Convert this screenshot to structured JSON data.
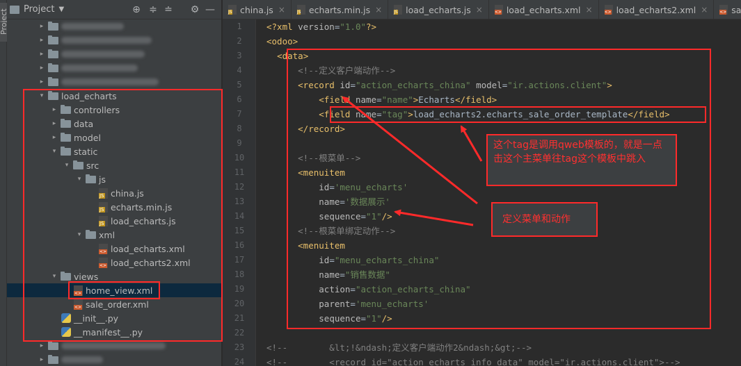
{
  "left_strip": {
    "label": "Project"
  },
  "project_panel": {
    "title": "Project",
    "tree": [
      {
        "label": "",
        "type": "folder",
        "blurred": true,
        "expanded": false
      },
      {
        "label": "",
        "type": "folder",
        "blurred": true,
        "expanded": false
      },
      {
        "label": "",
        "type": "folder",
        "blurred": true,
        "expanded": false
      },
      {
        "label": "",
        "type": "folder",
        "blurred": true,
        "expanded": false
      },
      {
        "label": "",
        "type": "folder",
        "blurred": true,
        "expanded": false
      },
      {
        "label": "load_echarts",
        "type": "folder",
        "expanded": true
      },
      {
        "label": "controllers",
        "type": "folder",
        "expanded": false
      },
      {
        "label": "data",
        "type": "folder",
        "expanded": false
      },
      {
        "label": "model",
        "type": "folder",
        "expanded": false
      },
      {
        "label": "static",
        "type": "folder",
        "expanded": true
      },
      {
        "label": "src",
        "type": "folder",
        "expanded": true
      },
      {
        "label": "js",
        "type": "folder",
        "expanded": true
      },
      {
        "label": "china.js",
        "type": "js"
      },
      {
        "label": "echarts.min.js",
        "type": "js"
      },
      {
        "label": "load_echarts.js",
        "type": "js"
      },
      {
        "label": "xml",
        "type": "folder",
        "expanded": true
      },
      {
        "label": "load_echarts.xml",
        "type": "xml"
      },
      {
        "label": "load_echarts2.xml",
        "type": "xml"
      },
      {
        "label": "views",
        "type": "folder",
        "expanded": true
      },
      {
        "label": "home_view.xml",
        "type": "xml",
        "selected": true
      },
      {
        "label": "sale_order.xml",
        "type": "xml"
      },
      {
        "label": "__init__.py",
        "type": "py"
      },
      {
        "label": "__manifest__.py",
        "type": "py"
      },
      {
        "label": "",
        "type": "folder",
        "blurred": true,
        "expanded": false
      },
      {
        "label": "",
        "type": "folder",
        "blurred": true,
        "expanded": false
      }
    ]
  },
  "tabs": [
    {
      "label": "china.js",
      "type": "js"
    },
    {
      "label": "echarts.min.js",
      "type": "js"
    },
    {
      "label": "load_echarts.js",
      "type": "js"
    },
    {
      "label": "load_echarts.xml",
      "type": "xml"
    },
    {
      "label": "load_echarts2.xml",
      "type": "xml"
    },
    {
      "label": "sale_order",
      "type": "xml"
    }
  ],
  "code_lines": [
    {
      "n": "1",
      "tokens": [
        [
          "pi",
          "<?xml "
        ],
        [
          "at",
          "version"
        ],
        [
          "tx",
          "="
        ],
        [
          "vl",
          "\"1.0\""
        ],
        [
          "pi",
          "?>"
        ]
      ]
    },
    {
      "n": "2",
      "tokens": [
        [
          "tg",
          "<odoo>"
        ]
      ]
    },
    {
      "n": "3",
      "tokens": [
        [
          "tx",
          "  "
        ],
        [
          "tg",
          "<data>"
        ]
      ]
    },
    {
      "n": "4",
      "tokens": [
        [
          "tx",
          "      "
        ],
        [
          "cm",
          "<!--定义客户端动作-->"
        ]
      ]
    },
    {
      "n": "5",
      "tokens": [
        [
          "tx",
          "      "
        ],
        [
          "tg",
          "<record "
        ],
        [
          "at",
          "id"
        ],
        [
          "tx",
          "="
        ],
        [
          "vl",
          "\"action_echarts_china\" "
        ],
        [
          "at",
          "model"
        ],
        [
          "tx",
          "="
        ],
        [
          "vl",
          "\"ir.actions.client\""
        ],
        [
          "tg",
          ">"
        ]
      ]
    },
    {
      "n": "6",
      "tokens": [
        [
          "tx",
          "          "
        ],
        [
          "tg",
          "<field "
        ],
        [
          "at",
          "name"
        ],
        [
          "tx",
          "="
        ],
        [
          "vl",
          "\"name\""
        ],
        [
          "tg",
          ">"
        ],
        [
          "tx",
          "Echarts"
        ],
        [
          "tg",
          "</field>"
        ]
      ]
    },
    {
      "n": "7",
      "tokens": [
        [
          "tx",
          "          "
        ],
        [
          "tg",
          "<field "
        ],
        [
          "at",
          "name"
        ],
        [
          "tx",
          "="
        ],
        [
          "vl",
          "\"tag\""
        ],
        [
          "tg",
          ">"
        ],
        [
          "tx",
          "load_echarts2.echarts_sale_order_template"
        ],
        [
          "tg",
          "</field>"
        ]
      ]
    },
    {
      "n": "8",
      "tokens": [
        [
          "tx",
          "      "
        ],
        [
          "tg",
          "</record>"
        ]
      ]
    },
    {
      "n": "9",
      "tokens": []
    },
    {
      "n": "10",
      "tokens": [
        [
          "tx",
          "      "
        ],
        [
          "cm",
          "<!--根菜单-->"
        ]
      ]
    },
    {
      "n": "11",
      "tokens": [
        [
          "tx",
          "      "
        ],
        [
          "tg",
          "<menuitem"
        ]
      ]
    },
    {
      "n": "12",
      "tokens": [
        [
          "tx",
          "          "
        ],
        [
          "at",
          "id"
        ],
        [
          "tx",
          "="
        ],
        [
          "vl",
          "'menu_echarts'"
        ]
      ]
    },
    {
      "n": "13",
      "tokens": [
        [
          "tx",
          "          "
        ],
        [
          "at",
          "name"
        ],
        [
          "tx",
          "="
        ],
        [
          "vl",
          "'数据展示'"
        ]
      ]
    },
    {
      "n": "14",
      "tokens": [
        [
          "tx",
          "          "
        ],
        [
          "at",
          "sequence"
        ],
        [
          "tx",
          "="
        ],
        [
          "vl",
          "\"1\""
        ],
        [
          "tg",
          "/>"
        ]
      ]
    },
    {
      "n": "15",
      "tokens": [
        [
          "tx",
          "      "
        ],
        [
          "cm",
          "<!--根菜单绑定动作-->"
        ]
      ]
    },
    {
      "n": "16",
      "tokens": [
        [
          "tx",
          "      "
        ],
        [
          "tg",
          "<menuitem"
        ]
      ]
    },
    {
      "n": "17",
      "tokens": [
        [
          "tx",
          "          "
        ],
        [
          "at",
          "id"
        ],
        [
          "tx",
          "="
        ],
        [
          "vl",
          "\"menu_echarts_china\""
        ]
      ]
    },
    {
      "n": "18",
      "tokens": [
        [
          "tx",
          "          "
        ],
        [
          "at",
          "name"
        ],
        [
          "tx",
          "="
        ],
        [
          "vl",
          "\"销售数据\""
        ]
      ]
    },
    {
      "n": "19",
      "tokens": [
        [
          "tx",
          "          "
        ],
        [
          "at",
          "action"
        ],
        [
          "tx",
          "="
        ],
        [
          "vl",
          "\"action_echarts_china\""
        ]
      ]
    },
    {
      "n": "20",
      "tokens": [
        [
          "tx",
          "          "
        ],
        [
          "at",
          "parent"
        ],
        [
          "tx",
          "="
        ],
        [
          "vl",
          "'menu_echarts'"
        ]
      ]
    },
    {
      "n": "21",
      "tokens": [
        [
          "tx",
          "          "
        ],
        [
          "at",
          "sequence"
        ],
        [
          "tx",
          "="
        ],
        [
          "vl",
          "\"1\""
        ],
        [
          "tg",
          "/>"
        ]
      ]
    },
    {
      "n": "22",
      "tokens": []
    },
    {
      "n": "23",
      "tokens": [
        [
          "cm",
          "<!--        &lt;!&ndash;定义客户端动作2&ndash;&gt;-->"
        ]
      ]
    },
    {
      "n": "24",
      "tokens": [
        [
          "cm",
          "<!--        <record id=\"action_echarts_info_data\" model=\"ir.actions.client\">-->"
        ]
      ]
    }
  ],
  "annotations": {
    "tag_note": "这个tag是调用qweb模板的，就是一点击这个主菜单往tag这个模板中跳入",
    "menu_note": "定义菜单和动作"
  },
  "colors": {
    "annotation_red": "#ff2a2a"
  }
}
